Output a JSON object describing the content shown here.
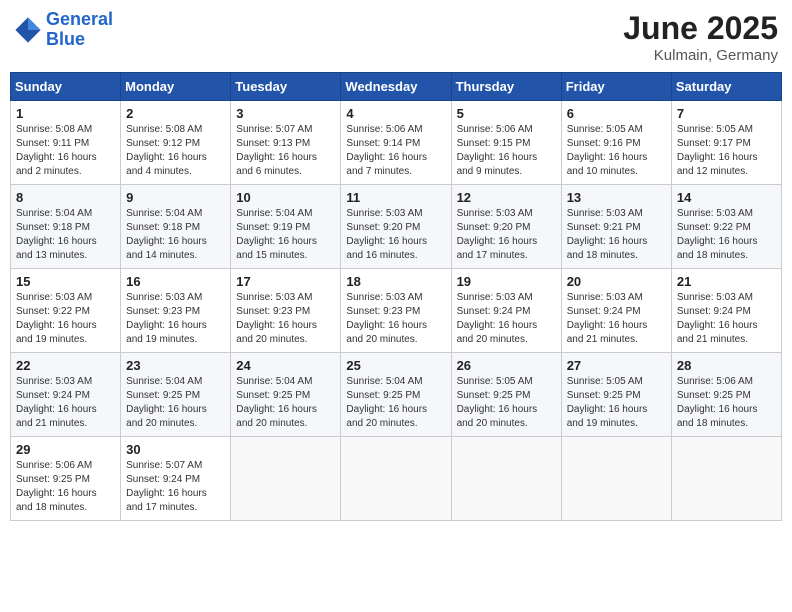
{
  "header": {
    "logo_line1": "General",
    "logo_line2": "Blue",
    "title": "June 2025",
    "subtitle": "Kulmain, Germany"
  },
  "weekdays": [
    "Sunday",
    "Monday",
    "Tuesday",
    "Wednesday",
    "Thursday",
    "Friday",
    "Saturday"
  ],
  "weeks": [
    [
      {
        "day": "1",
        "info": "Sunrise: 5:08 AM\nSunset: 9:11 PM\nDaylight: 16 hours\nand 2 minutes."
      },
      {
        "day": "2",
        "info": "Sunrise: 5:08 AM\nSunset: 9:12 PM\nDaylight: 16 hours\nand 4 minutes."
      },
      {
        "day": "3",
        "info": "Sunrise: 5:07 AM\nSunset: 9:13 PM\nDaylight: 16 hours\nand 6 minutes."
      },
      {
        "day": "4",
        "info": "Sunrise: 5:06 AM\nSunset: 9:14 PM\nDaylight: 16 hours\nand 7 minutes."
      },
      {
        "day": "5",
        "info": "Sunrise: 5:06 AM\nSunset: 9:15 PM\nDaylight: 16 hours\nand 9 minutes."
      },
      {
        "day": "6",
        "info": "Sunrise: 5:05 AM\nSunset: 9:16 PM\nDaylight: 16 hours\nand 10 minutes."
      },
      {
        "day": "7",
        "info": "Sunrise: 5:05 AM\nSunset: 9:17 PM\nDaylight: 16 hours\nand 12 minutes."
      }
    ],
    [
      {
        "day": "8",
        "info": "Sunrise: 5:04 AM\nSunset: 9:18 PM\nDaylight: 16 hours\nand 13 minutes."
      },
      {
        "day": "9",
        "info": "Sunrise: 5:04 AM\nSunset: 9:18 PM\nDaylight: 16 hours\nand 14 minutes."
      },
      {
        "day": "10",
        "info": "Sunrise: 5:04 AM\nSunset: 9:19 PM\nDaylight: 16 hours\nand 15 minutes."
      },
      {
        "day": "11",
        "info": "Sunrise: 5:03 AM\nSunset: 9:20 PM\nDaylight: 16 hours\nand 16 minutes."
      },
      {
        "day": "12",
        "info": "Sunrise: 5:03 AM\nSunset: 9:20 PM\nDaylight: 16 hours\nand 17 minutes."
      },
      {
        "day": "13",
        "info": "Sunrise: 5:03 AM\nSunset: 9:21 PM\nDaylight: 16 hours\nand 18 minutes."
      },
      {
        "day": "14",
        "info": "Sunrise: 5:03 AM\nSunset: 9:22 PM\nDaylight: 16 hours\nand 18 minutes."
      }
    ],
    [
      {
        "day": "15",
        "info": "Sunrise: 5:03 AM\nSunset: 9:22 PM\nDaylight: 16 hours\nand 19 minutes."
      },
      {
        "day": "16",
        "info": "Sunrise: 5:03 AM\nSunset: 9:23 PM\nDaylight: 16 hours\nand 19 minutes."
      },
      {
        "day": "17",
        "info": "Sunrise: 5:03 AM\nSunset: 9:23 PM\nDaylight: 16 hours\nand 20 minutes."
      },
      {
        "day": "18",
        "info": "Sunrise: 5:03 AM\nSunset: 9:23 PM\nDaylight: 16 hours\nand 20 minutes."
      },
      {
        "day": "19",
        "info": "Sunrise: 5:03 AM\nSunset: 9:24 PM\nDaylight: 16 hours\nand 20 minutes."
      },
      {
        "day": "20",
        "info": "Sunrise: 5:03 AM\nSunset: 9:24 PM\nDaylight: 16 hours\nand 21 minutes."
      },
      {
        "day": "21",
        "info": "Sunrise: 5:03 AM\nSunset: 9:24 PM\nDaylight: 16 hours\nand 21 minutes."
      }
    ],
    [
      {
        "day": "22",
        "info": "Sunrise: 5:03 AM\nSunset: 9:24 PM\nDaylight: 16 hours\nand 21 minutes."
      },
      {
        "day": "23",
        "info": "Sunrise: 5:04 AM\nSunset: 9:25 PM\nDaylight: 16 hours\nand 20 minutes."
      },
      {
        "day": "24",
        "info": "Sunrise: 5:04 AM\nSunset: 9:25 PM\nDaylight: 16 hours\nand 20 minutes."
      },
      {
        "day": "25",
        "info": "Sunrise: 5:04 AM\nSunset: 9:25 PM\nDaylight: 16 hours\nand 20 minutes."
      },
      {
        "day": "26",
        "info": "Sunrise: 5:05 AM\nSunset: 9:25 PM\nDaylight: 16 hours\nand 20 minutes."
      },
      {
        "day": "27",
        "info": "Sunrise: 5:05 AM\nSunset: 9:25 PM\nDaylight: 16 hours\nand 19 minutes."
      },
      {
        "day": "28",
        "info": "Sunrise: 5:06 AM\nSunset: 9:25 PM\nDaylight: 16 hours\nand 18 minutes."
      }
    ],
    [
      {
        "day": "29",
        "info": "Sunrise: 5:06 AM\nSunset: 9:25 PM\nDaylight: 16 hours\nand 18 minutes."
      },
      {
        "day": "30",
        "info": "Sunrise: 5:07 AM\nSunset: 9:24 PM\nDaylight: 16 hours\nand 17 minutes."
      },
      {
        "day": "",
        "info": ""
      },
      {
        "day": "",
        "info": ""
      },
      {
        "day": "",
        "info": ""
      },
      {
        "day": "",
        "info": ""
      },
      {
        "day": "",
        "info": ""
      }
    ]
  ]
}
